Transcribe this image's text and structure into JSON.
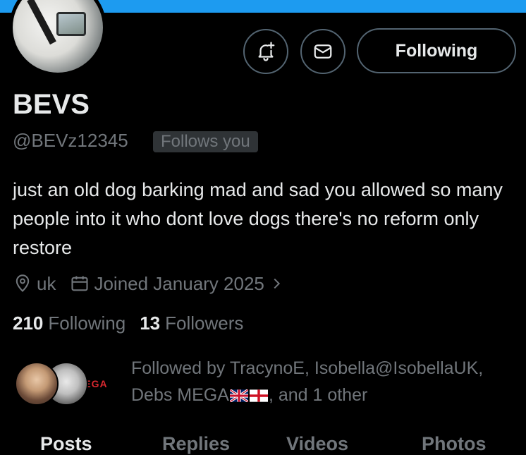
{
  "profile": {
    "name": "BEVS",
    "handle": "@BEVz12345",
    "follows_you_badge": "Follows you",
    "bio": "just an old dog barking mad and sad you allowed so many people into it who dont love dogs there's no reform only restore",
    "location": "uk",
    "joined": "Joined January 2025",
    "following_count": "210",
    "following_label": "Following",
    "followers_count": "13",
    "followers_label": "Followers"
  },
  "actions": {
    "follow_button": "Following",
    "notify_icon": "bell-plus-icon",
    "dm_icon": "envelope-icon"
  },
  "followed_by": {
    "prefix": "Followed by TracynoE, Isobella@IsobellaUK,",
    "line2_name": "Debs MEGA",
    "suffix": ", and 1 other",
    "third_avatar_text": "EGA"
  },
  "tabs": [
    "Posts",
    "Replies",
    "Videos",
    "Photos"
  ],
  "colors": {
    "background": "#000000",
    "banner": "#1d9bf0",
    "primary_text": "#e7e9ea",
    "secondary_text": "#71767b",
    "border": "#536471"
  }
}
